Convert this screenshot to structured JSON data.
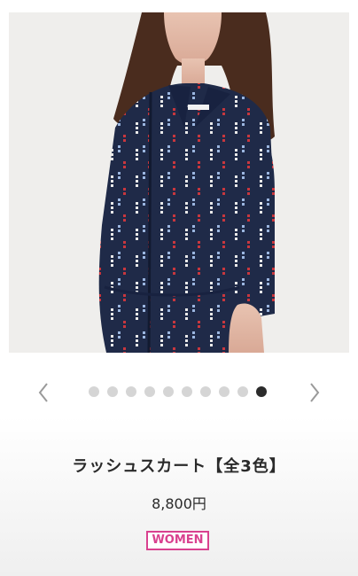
{
  "product": {
    "image_alt": "product photo: navy patterned rash guard",
    "title": "ラッシュスカート【全3色】",
    "price": "8,800円",
    "category_badge": "WOMEN"
  },
  "carousel": {
    "total_slides": 10,
    "active_index": 9,
    "prev_icon": "chevron-left-icon",
    "next_icon": "chevron-right-icon"
  },
  "colors": {
    "accent_badge": "#d9418f",
    "dot_inactive": "#d5d5d5",
    "dot_active": "#2b2b2b",
    "garment_navy": "#1f2a48"
  }
}
